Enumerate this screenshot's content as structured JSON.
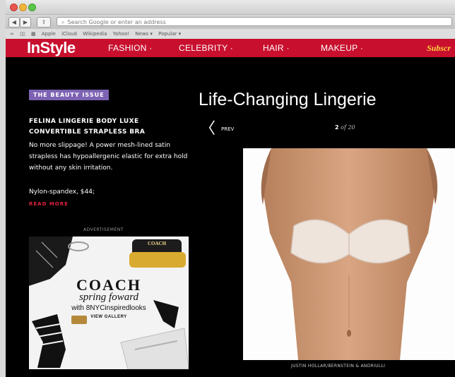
{
  "browser": {
    "address_placeholder": "Search Google or enter an address",
    "bookmarks": [
      "Apple",
      "iCloud",
      "Wikipedia",
      "Yahoo!",
      "News ▾",
      "Popular ▾"
    ]
  },
  "site": {
    "logo": "InStyle",
    "nav": [
      "FASHION ·",
      "CELEBRITY ·",
      "HAIR ·",
      "MAKEUP ·"
    ],
    "subscribe": "Subscr"
  },
  "article": {
    "badge": "THE BEAUTY ISSUE",
    "product_title": "FELINA LINGERIE BODY LUXE CONVERTIBLE STRAPLESS BRA",
    "description": "No more slippage! A power mesh-lined satin strapless has hypoallergenic elastic for extra hold without any skin irritation.",
    "price": "Nylon-spandex, $44;",
    "read_more": "READ MORE"
  },
  "gallery": {
    "title": "Life-Changing Lingerie",
    "prev_label": "PREV",
    "current": "2",
    "of_label": "of 20",
    "credit": "JUSTIN HOLLAR/BERNSTEIN & ANDRIULLI"
  },
  "ad": {
    "label": "ADVERTISEMENT",
    "brand": "COACH",
    "tagline": "spring foward",
    "subline": "with 8NYCinspiredlooks",
    "cta": "VIEW GALLERY",
    "bottle_text": "COACH"
  },
  "colors": {
    "nav_red": "#c8102e",
    "badge_purple": "#7d62b3",
    "read_more_red": "#e0223c",
    "subscribe_yellow": "#ffd23a"
  }
}
